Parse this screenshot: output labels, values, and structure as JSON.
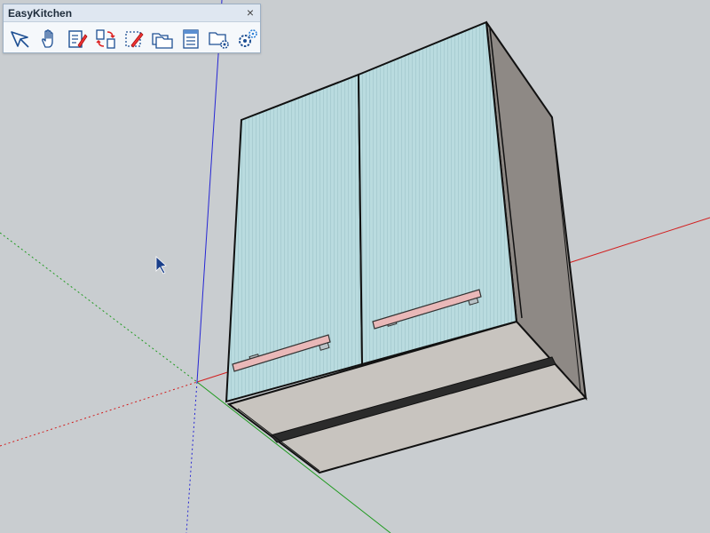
{
  "toolbar": {
    "title": "EasyKitchen",
    "close_glyph": "×",
    "buttons": [
      {
        "name": "select-tool-icon"
      },
      {
        "name": "pan-hand-icon"
      },
      {
        "name": "edit-document-icon"
      },
      {
        "name": "swap-components-icon"
      },
      {
        "name": "edit-selection-icon"
      },
      {
        "name": "open-folders-icon"
      },
      {
        "name": "list-table-icon"
      },
      {
        "name": "folder-settings-icon"
      },
      {
        "name": "settings-gears-icon"
      }
    ]
  },
  "scene": {
    "axis_colors": {
      "red": "#d21f1f",
      "green": "#1f9a1f",
      "blue": "#2626d4"
    },
    "door_color": "#b8dade",
    "carcass_color": "#8e8985",
    "bottom_color": "#c8c4bf",
    "handle_color": "#e9b8b8"
  }
}
